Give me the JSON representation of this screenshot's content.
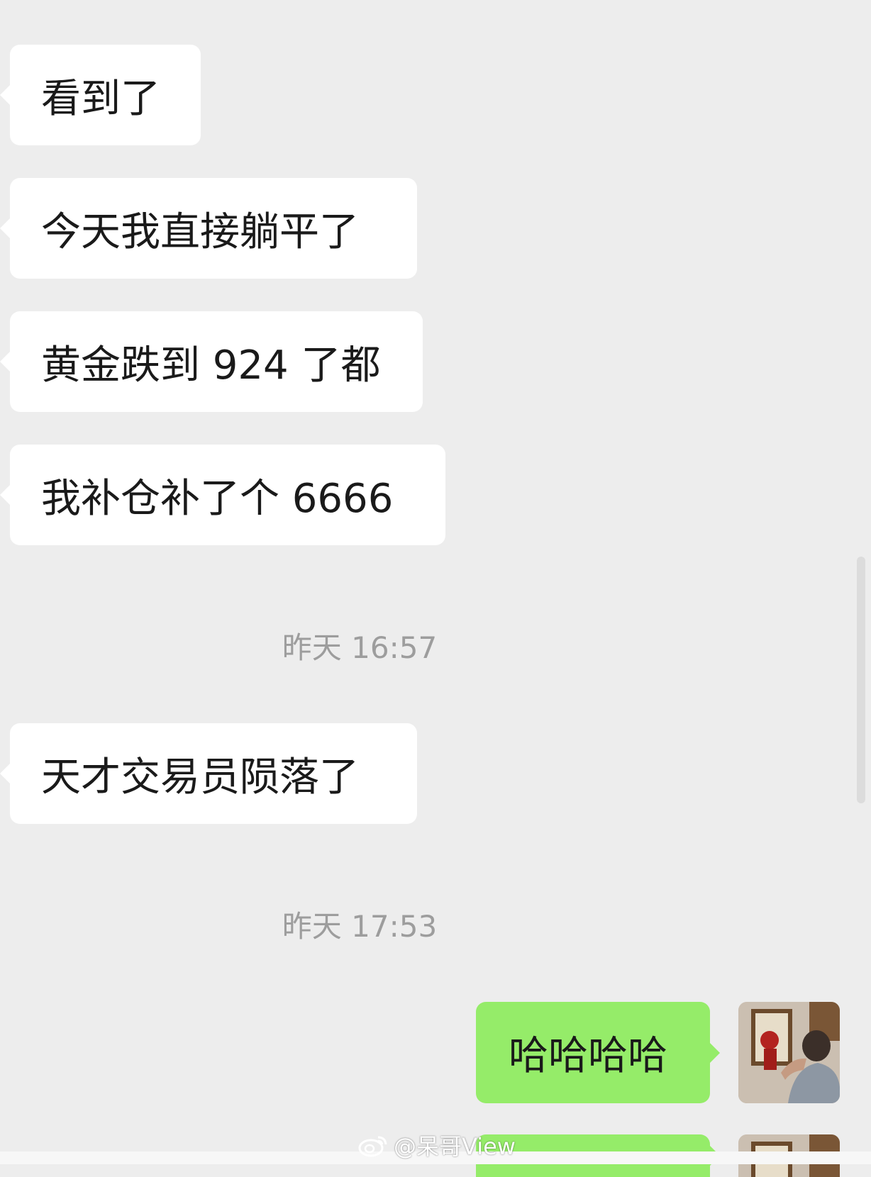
{
  "messages": [
    {
      "text": "看到了"
    },
    {
      "text": "今天我直接躺平了"
    },
    {
      "text": "黄金跌到 924 了都"
    },
    {
      "text": "我补仓补了个 6666"
    },
    {
      "text": "天才交易员陨落了"
    }
  ],
  "timestamps": [
    "昨天 16:57",
    "昨天 17:53"
  ],
  "my_messages": [
    {
      "text": "哈哈哈哈"
    }
  ],
  "watermark": {
    "icon": "weibo-icon",
    "text": "@呆哥View"
  },
  "colors": {
    "background": "#ededed",
    "incoming_bubble": "#ffffff",
    "outgoing_bubble": "#95ec69",
    "timestamp": "#9d9d9d"
  }
}
